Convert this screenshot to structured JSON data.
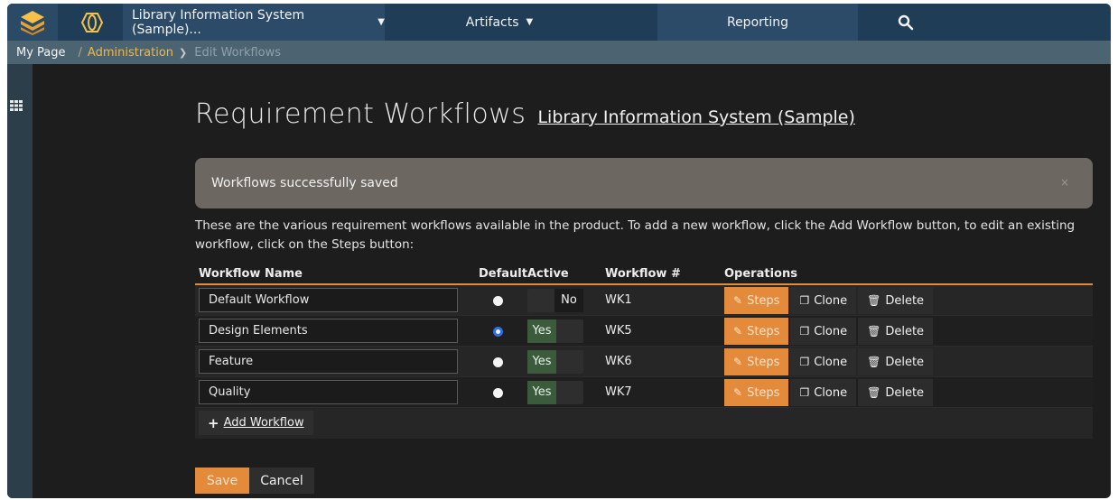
{
  "nav": {
    "project_label": "Library Information System (Sample)...",
    "artifacts_label": "Artifacts",
    "reporting_label": "Reporting"
  },
  "breadcrumb": {
    "home": "My Page",
    "separator": "/",
    "admin": "Administration",
    "current": "Edit Workflows"
  },
  "page": {
    "title": "Requirement Workflows",
    "project_link": "Library Information System (Sample)",
    "alert_text": "Workflows successfully saved",
    "alert_close": "×",
    "description": "These are the various requirement workflows available in the product. To add a new workflow, click the Add Workflow button, to edit an existing workflow, click on the Steps button:"
  },
  "table": {
    "headers": {
      "name": "Workflow Name",
      "default": "Default",
      "active": "Active",
      "number": "Workflow #",
      "operations": "Operations"
    },
    "rows": [
      {
        "name": "Default Workflow",
        "default": false,
        "active": "No",
        "number": "WK1"
      },
      {
        "name": "Design Elements",
        "default": true,
        "active": "Yes",
        "number": "WK5"
      },
      {
        "name": "Feature",
        "default": false,
        "active": "Yes",
        "number": "WK6"
      },
      {
        "name": "Quality",
        "default": false,
        "active": "Yes",
        "number": "WK7"
      }
    ],
    "ops": {
      "steps": "Steps",
      "clone": "Clone",
      "delete": "Delete"
    },
    "add_label": "Add Workflow"
  },
  "footer": {
    "save": "Save",
    "cancel": "Cancel"
  },
  "colors": {
    "accent": "#e48a3b",
    "nav": "#1f3d56",
    "breadcrumb": "#4c6472",
    "admin_link": "#e9b94b",
    "radio_selected": "#2f6fe0"
  }
}
